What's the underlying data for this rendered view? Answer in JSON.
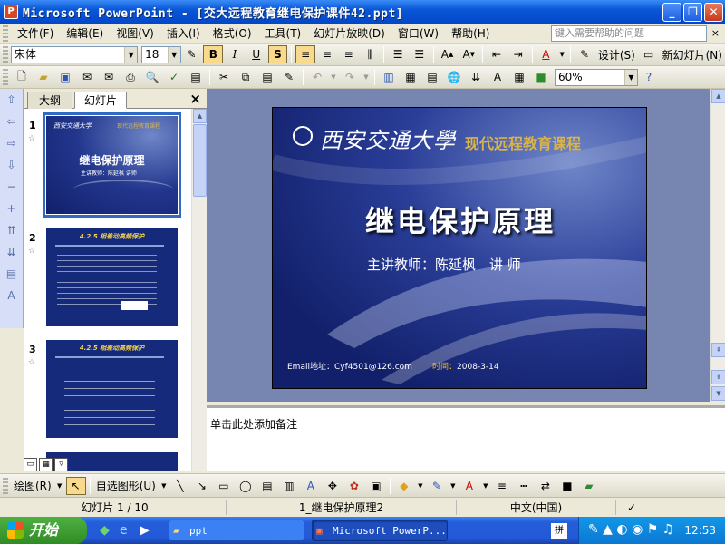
{
  "window": {
    "title": "Microsoft PowerPoint - [交大远程教育继电保护课件42.ppt]",
    "minimize": "_",
    "restore": "❐",
    "close": "✕"
  },
  "menu": {
    "items": [
      "文件(F)",
      "编辑(E)",
      "视图(V)",
      "插入(I)",
      "格式(O)",
      "工具(T)",
      "幻灯片放映(D)",
      "窗口(W)",
      "帮助(H)"
    ],
    "help_placeholder": "键入需要帮助的问题"
  },
  "format_toolbar": {
    "font": "宋体",
    "size": "18",
    "bold": "B",
    "italic": "I",
    "underline": "U",
    "shadow": "S",
    "design": "设计(S)",
    "new_slide": "新幻灯片(N)"
  },
  "standard_toolbar": {
    "zoom": "60%"
  },
  "outline_panel": {
    "tab_outline": "大纲",
    "tab_slides": "幻灯片",
    "close": "×",
    "slides": [
      {
        "num": "1",
        "selected": true,
        "logo": "西安交通大学",
        "course": "现代远程教育课程",
        "title": "继电保护原理",
        "sub": "主讲教师：陈延枫 讲师"
      },
      {
        "num": "2",
        "selected": false,
        "title": "4.2.5 相差动高频保护"
      },
      {
        "num": "3",
        "selected": false,
        "title": "4.2.5 相差动高频保护"
      }
    ]
  },
  "main_slide": {
    "logo": "西安交通大學",
    "course": "现代远程教育课程",
    "title": "继电保护原理",
    "lecturer": "主讲教师：陈延枫　讲 师",
    "email_label": "Email地址：",
    "email": "Cyf4501@126.com",
    "date_label": "时间：",
    "date": "2008-3-14"
  },
  "notes": {
    "placeholder": "单击此处添加备注"
  },
  "drawing_toolbar": {
    "draw": "绘图(R)",
    "autoshapes": "自选图形(U)"
  },
  "status": {
    "slide": "幻灯片 1 / 10",
    "design": "1_继电保护原理2",
    "language": "中文(中国)"
  },
  "taskbar": {
    "start": "开始",
    "tasks": [
      "ppt",
      "Microsoft PowerP..."
    ],
    "clock": "12:53"
  }
}
